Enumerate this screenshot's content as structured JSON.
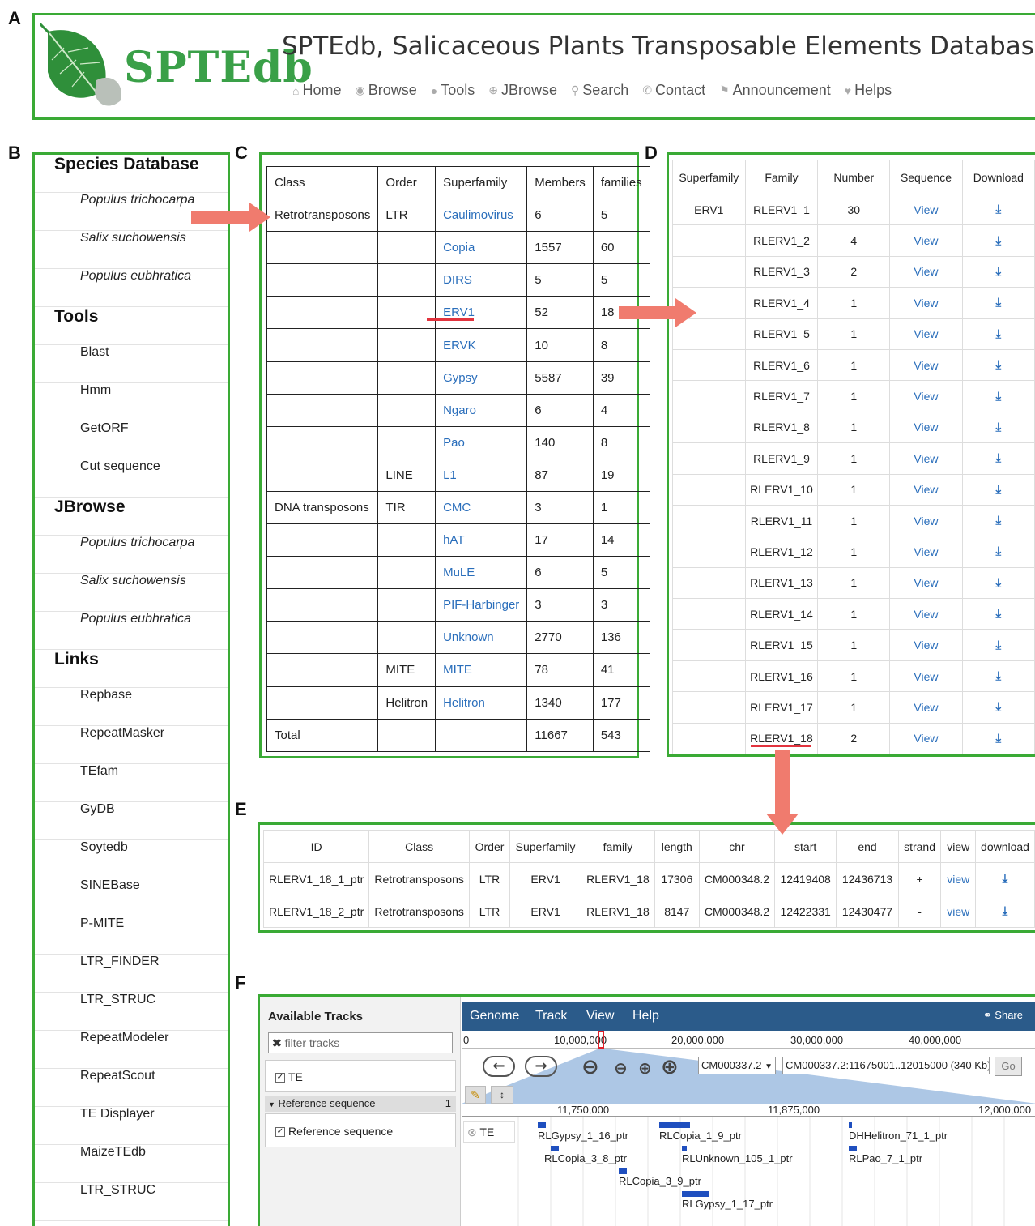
{
  "panel_letters": {
    "a": "A",
    "b": "B",
    "c": "C",
    "d": "D",
    "e": "E",
    "f": "F"
  },
  "header": {
    "logo_text": "SPTEdb",
    "title": "SPTEdb, Salicaceous Plants Transposable Elements Database",
    "nav": [
      {
        "icon": "home-icon",
        "label": "Home"
      },
      {
        "icon": "eye-icon",
        "label": "Browse"
      },
      {
        "icon": "tag-icon",
        "label": "Tools"
      },
      {
        "icon": "zoom-in-icon",
        "label": "JBrowse"
      },
      {
        "icon": "search-icon",
        "label": "Search"
      },
      {
        "icon": "phone-icon",
        "label": "Contact"
      },
      {
        "icon": "bullhorn-icon",
        "label": "Announcement"
      },
      {
        "icon": "heart-icon",
        "label": "Helps"
      }
    ]
  },
  "sidebar": {
    "sections": [
      {
        "title": "Species Database",
        "items": [
          "Populus trichocarpa",
          "Salix suchowensis",
          "Populus eubhratica"
        ],
        "italic": true
      },
      {
        "title": "Tools",
        "items": [
          "Blast",
          "Hmm",
          "GetORF",
          "Cut sequence"
        ],
        "italic": false
      },
      {
        "title": "JBrowse",
        "items": [
          "Populus trichocarpa",
          "Salix suchowensis",
          "Populus eubhratica"
        ],
        "italic": true
      },
      {
        "title": "Links",
        "items": [
          "Repbase",
          "RepeatMasker",
          "TEfam",
          "GyDB",
          "Soytedb",
          "SINEBase",
          "P-MITE",
          "LTR_FINDER",
          "LTR_STRUC",
          "RepeatModeler",
          "RepeatScout",
          "TE Displayer",
          "MaizeTEdb",
          "LTR_STRUC"
        ],
        "italic": false
      }
    ]
  },
  "table_c": {
    "headers": [
      "Class",
      "Order",
      "Superfamily",
      "Members",
      "families"
    ],
    "rows": [
      [
        "Retrotransposons",
        "LTR",
        "Caulimovirus",
        "6",
        "5"
      ],
      [
        "",
        "",
        "Copia",
        "1557",
        "60"
      ],
      [
        "",
        "",
        "DIRS",
        "5",
        "5"
      ],
      [
        "",
        "",
        "ERV1",
        "52",
        "18"
      ],
      [
        "",
        "",
        "ERVK",
        "10",
        "8"
      ],
      [
        "",
        "",
        "Gypsy",
        "5587",
        "39"
      ],
      [
        "",
        "",
        "Ngaro",
        "6",
        "4"
      ],
      [
        "",
        "",
        "Pao",
        "140",
        "8"
      ],
      [
        "",
        "LINE",
        "L1",
        "87",
        "19"
      ],
      [
        "DNA transposons",
        "TIR",
        "CMC",
        "3",
        "1"
      ],
      [
        "",
        "",
        "hAT",
        "17",
        "14"
      ],
      [
        "",
        "",
        "MuLE",
        "6",
        "5"
      ],
      [
        "",
        "",
        "PIF-Harbinger",
        "3",
        "3"
      ],
      [
        "",
        "",
        "Unknown",
        "2770",
        "136"
      ],
      [
        "",
        "MITE",
        "MITE",
        "78",
        "41"
      ],
      [
        "",
        "Helitron",
        "Helitron",
        "1340",
        "177"
      ],
      [
        "Total",
        "",
        "",
        "11667",
        "543"
      ]
    ]
  },
  "table_d": {
    "headers": [
      "Superfamily",
      "Family",
      "Number",
      "Sequence",
      "Download"
    ],
    "superfamily": "ERV1",
    "view_label": "View",
    "rows": [
      [
        "RLERV1_1",
        "30"
      ],
      [
        "RLERV1_2",
        "4"
      ],
      [
        "RLERV1_3",
        "2"
      ],
      [
        "RLERV1_4",
        "1"
      ],
      [
        "RLERV1_5",
        "1"
      ],
      [
        "RLERV1_6",
        "1"
      ],
      [
        "RLERV1_7",
        "1"
      ],
      [
        "RLERV1_8",
        "1"
      ],
      [
        "RLERV1_9",
        "1"
      ],
      [
        "RLERV1_10",
        "1"
      ],
      [
        "RLERV1_11",
        "1"
      ],
      [
        "RLERV1_12",
        "1"
      ],
      [
        "RLERV1_13",
        "1"
      ],
      [
        "RLERV1_14",
        "1"
      ],
      [
        "RLERV1_15",
        "1"
      ],
      [
        "RLERV1_16",
        "1"
      ],
      [
        "RLERV1_17",
        "1"
      ],
      [
        "RLERV1_18",
        "2"
      ]
    ]
  },
  "table_e": {
    "headers": [
      "ID",
      "Class",
      "Order",
      "Superfamily",
      "family",
      "length",
      "chr",
      "start",
      "end",
      "strand",
      "view",
      "download"
    ],
    "view_label": "view",
    "rows": [
      [
        "RLERV1_18_1_ptr",
        "Retrotransposons",
        "LTR",
        "ERV1",
        "RLERV1_18",
        "17306",
        "CM000348.2",
        "12419408",
        "12436713",
        "+"
      ],
      [
        "RLERV1_18_2_ptr",
        "Retrotransposons",
        "LTR",
        "ERV1",
        "RLERV1_18",
        "8147",
        "CM000348.2",
        "12422331",
        "12430477",
        "-"
      ]
    ]
  },
  "jbrowse": {
    "available_tracks": "Available Tracks",
    "filter_placeholder": "filter tracks",
    "track_te": "TE",
    "reference_header": "Reference sequence",
    "reference_count": "1",
    "reference_track": "Reference sequence",
    "menu": [
      "Genome",
      "Track",
      "View",
      "Help"
    ],
    "share": "Share",
    "ruler_labels": [
      "0",
      "10,000,000",
      "20,000,000",
      "30,000,000",
      "40,000,000"
    ],
    "chrom": "CM000337.2",
    "location": "CM000337.2:11675001..12015000 (340 Kb)",
    "go": "Go",
    "scale_labels": [
      "11,750,000",
      "11,875,000",
      "12,000,000"
    ],
    "te_track_label": "TE",
    "features": [
      "RLGypsy_1_16_ptr",
      "RLCopia_3_8_ptr",
      "RLCopia_3_9_ptr",
      "RLCopia_1_9_ptr",
      "RLUnknown_105_1_ptr",
      "RLGypsy_1_17_ptr",
      "DHHelitron_71_1_ptr",
      "RLPao_7_1_ptr"
    ]
  },
  "colors": {
    "frame": "#3aaa35",
    "link": "#2a6ebb",
    "arrow": "#f07b6e",
    "brand": "#3aa048"
  }
}
